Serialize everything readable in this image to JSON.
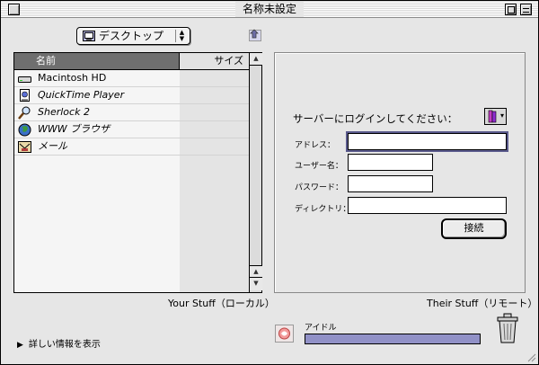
{
  "window": {
    "title": "名称未設定"
  },
  "location_popup": {
    "selected": "デスクトップ",
    "icon": "desktop-folder-icon"
  },
  "local_list": {
    "columns": [
      "名前",
      "サイズ"
    ],
    "items": [
      {
        "name": "Macintosh HD",
        "icon": "hard-disk-icon",
        "size": ""
      },
      {
        "name": "QuickTime Player",
        "icon": "quicktime-icon",
        "size": ""
      },
      {
        "name": "Sherlock 2",
        "icon": "sherlock-icon",
        "size": ""
      },
      {
        "name": "WWW ブラウザ",
        "icon": "browser-icon",
        "size": ""
      },
      {
        "name": "メール",
        "icon": "mail-icon",
        "size": ""
      }
    ],
    "label": "Your Stuff（ローカル）"
  },
  "remote": {
    "label": "Their Stuff（リモート）",
    "login_prompt": "サーバーにログインしてください：",
    "fields": {
      "address_label": "アドレス：",
      "address_value": "",
      "user_label": "ユーザー名：",
      "user_value": "",
      "password_label": "パスワード：",
      "password_value": "",
      "directory_label": "ディレクトリ：",
      "directory_value": ""
    },
    "connect_label": "接続"
  },
  "footer": {
    "details_label": "詳しい情報を表示",
    "status_text": "アイドル",
    "progress": 1.0
  },
  "colors": {
    "progress_fill": "#9191c7",
    "header_bg": "#6f6f6f",
    "window_bg": "#e6e6e6"
  }
}
